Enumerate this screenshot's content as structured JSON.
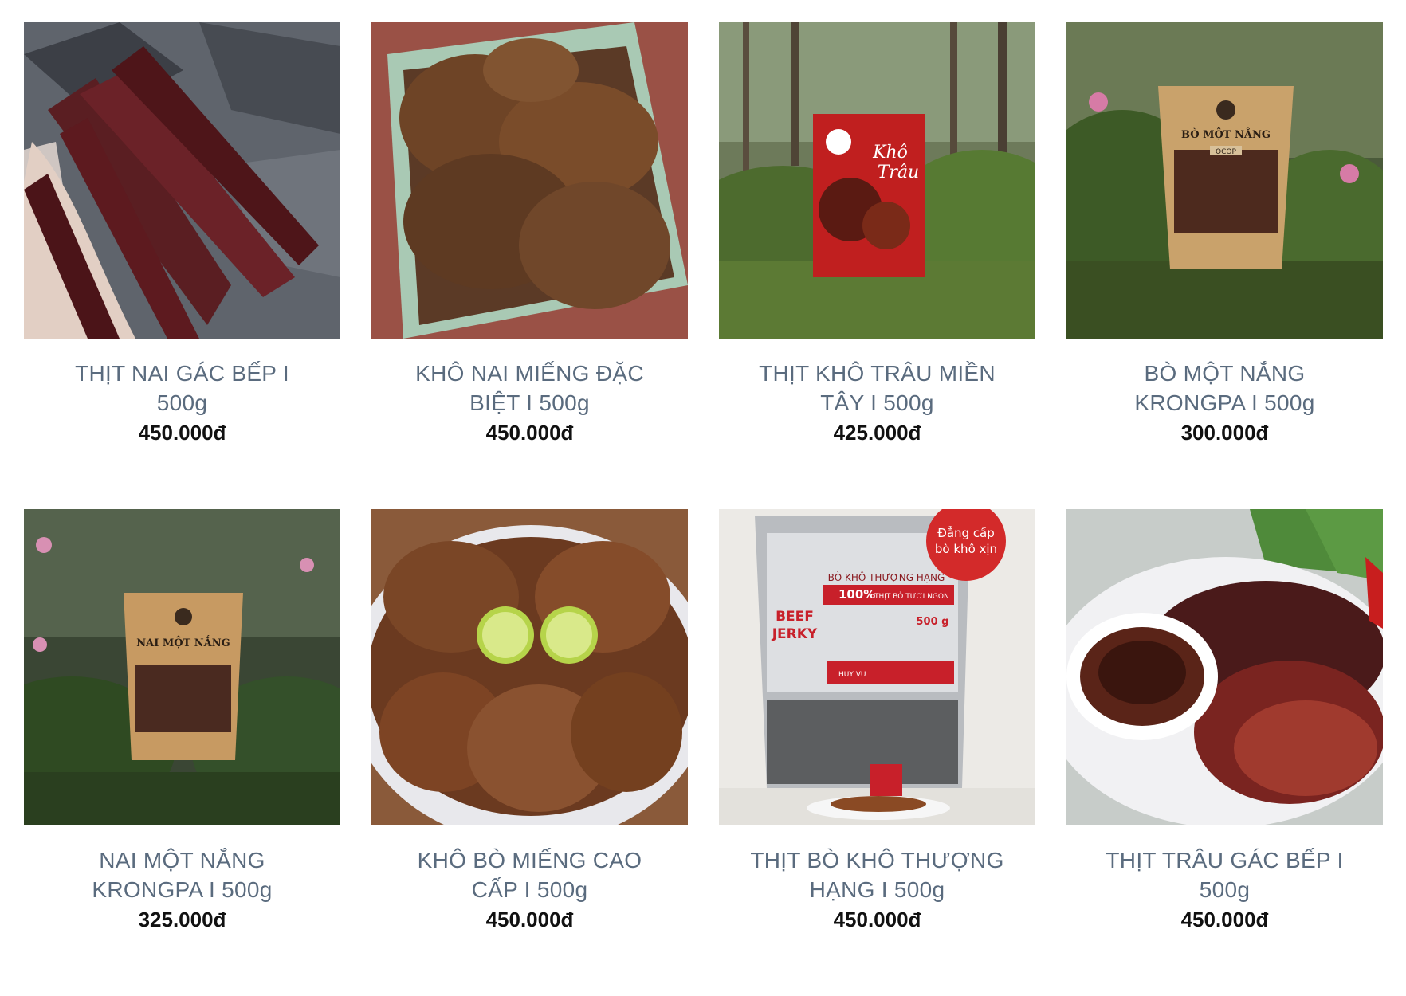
{
  "products": [
    {
      "name": "THỊT NAI GÁC BẾP I 500g",
      "price": "450.000đ",
      "image": "dried-venison-strips-photo"
    },
    {
      "name": "KHÔ NAI MIẾNG ĐẶC BIỆT I 500g",
      "price": "450.000đ",
      "image": "venison-jerky-pieces-photo"
    },
    {
      "name": "THỊT KHÔ TRÂU MIỀN TÂY I 500g",
      "price": "425.000đ",
      "image": "buffalo-jerky-red-pack-photo",
      "pack_text": [
        "Khô",
        "Trâu"
      ]
    },
    {
      "name": "BÒ MỘT NẮNG KRONGPA I 500g",
      "price": "300.000đ",
      "image": "beef-kraft-pack-photo",
      "pack_text": [
        "BÒ MỘT NẮNG",
        "OCOP"
      ]
    },
    {
      "name": "NAI MỘT NẮNG KRONGPA I 500g",
      "price": "325.000đ",
      "image": "venison-kraft-pack-photo",
      "pack_text": [
        "NAI MỘT NẮNG"
      ]
    },
    {
      "name": "KHÔ BÒ MIẾNG CAO CẤP I 500g",
      "price": "450.000đ",
      "image": "beef-jerky-lime-plate-photo"
    },
    {
      "name": "THỊT BÒ KHÔ THƯỢNG HẠNG I 500g",
      "price": "450.000đ",
      "image": "beef-jerky-pack-photo",
      "pack_text": [
        "Đẳng cấp",
        "bò khô xịn",
        "BÒ KHÔ THƯỢNG HẠNG",
        "100%",
        "THỊT BÒ TƯƠI NGON",
        "BEEF",
        "JERKY",
        "500 g",
        "HUY VU"
      ]
    },
    {
      "name": "THỊT TRÂU GÁC BẾP I 500g",
      "price": "450.000đ",
      "image": "buffalo-jerky-sauce-plate-photo"
    }
  ]
}
